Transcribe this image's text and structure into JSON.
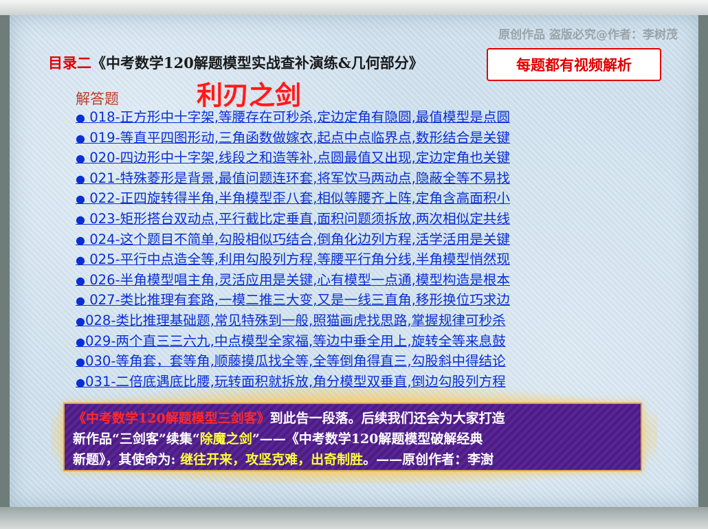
{
  "watermark": "原创作品 盗版必究@作者：李树茂",
  "title": {
    "prefix": "目录二",
    "main": "《中考数学120解题模型实战查补演练&几何部分》"
  },
  "video_badge": "每题都有视频解析",
  "section_label": "解答题",
  "big_title": "利刃之剑",
  "items": [
    {
      "bullet": "●",
      "text": " 018-正方形中十字架,等腰存在可秒杀,定边定角有隐圆,最值模型是点圆"
    },
    {
      "bullet": "●",
      "text": " 019-等直平四图形动,三角函数做嫁衣,起点中点临界点,数形结合是关键"
    },
    {
      "bullet": "●",
      "text": " 020-四边形中十字架,线段之和造等补,点圆最值又出现,定边定角也关键"
    },
    {
      "bullet": "●",
      "text": " 021-特殊菱形是背景,最值问题连环套,将军饮马两动点,隐蔽全等不易找"
    },
    {
      "bullet": "●",
      "text": " 022-正四旋转得半角,半角模型歪八套,相似等腰齐上阵,定角含高面积小"
    },
    {
      "bullet": "●",
      "text": " 023-矩形搭台双动点,平行截比定垂直,面积问题须拆放,两次相似定共线"
    },
    {
      "bullet": "●",
      "text": " 024-这个题目不简单,勾股相似巧结合,倒角化边列方程,活学活用是关键"
    },
    {
      "bullet": "●",
      "text": " 025-平行中点造全等,利用勾股列方程,等腰平行角分线,半角模型悄然现"
    },
    {
      "bullet": "●",
      "text": " 026-半角模型唱主角,灵活应用是关键,心有模型一点通,模型构造是根本"
    },
    {
      "bullet": "●",
      "text": " 027-类比推理有套路,一模二推三大变,又是一线三直角,移形换位巧求边"
    },
    {
      "bullet": "●",
      "text": "028-类比推理基础题,常见特殊到一般,照猫画虎找思路,掌握规律可秒杀"
    },
    {
      "bullet": "●",
      "text": "029-两个直三三六九,中点模型全家福,等边中垂全用上,旋转全等来息鼓"
    },
    {
      "bullet": "●",
      "text": "030-等角套，套等角,顺藤摸瓜找全等,全等倒角得直三,勾股斜中得结论"
    },
    {
      "bullet": "●",
      "text": "031-二倍底遇底比腰,玩转面积就拆放,角分模型双垂直,倒边勾股列方程"
    }
  ],
  "banner": {
    "line1_red": "《中考数学120解题模型三剑客》",
    "line1_white": "到此告一段落。后续我们还会为大家打造",
    "line2_a": "新作品“三剑客”续集“",
    "line2_yellow": "除魔之剑",
    "line2_b": "”——《中考数学120解题模型破解经典",
    "line3_a": "新题》，其使命为: ",
    "line3_yellow": "继往开来，攻坚克难，出奇制胜",
    "line3_b": "。——原创作者：李澍"
  }
}
